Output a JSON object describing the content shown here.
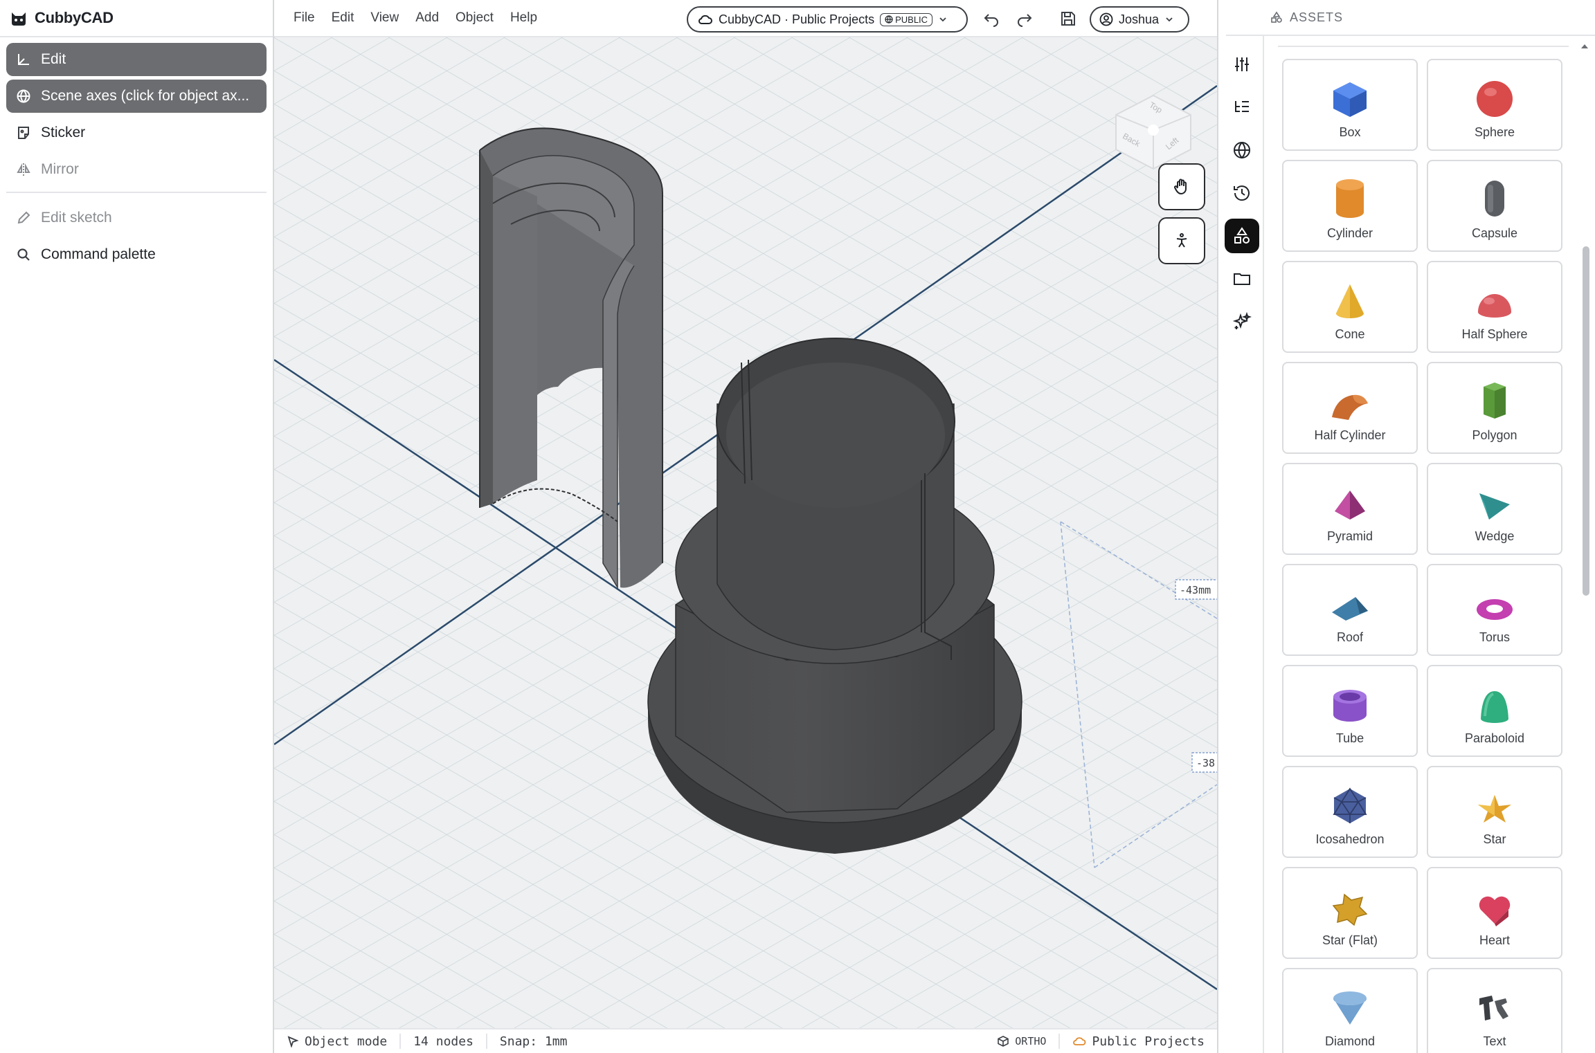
{
  "app": {
    "name": "CubbyCAD"
  },
  "left_menu": {
    "items": [
      {
        "label": "Edit",
        "icon": "axis-icon",
        "state": "active"
      },
      {
        "label": "Scene axes (click for object ax...",
        "icon": "globe-icon",
        "state": "active"
      },
      {
        "label": "Sticker",
        "icon": "sticker-icon",
        "state": "normal"
      },
      {
        "label": "Mirror",
        "icon": "mirror-icon",
        "state": "disabled"
      },
      {
        "label": "Edit sketch",
        "icon": "pencil-icon",
        "state": "disabled"
      },
      {
        "label": "Command palette",
        "icon": "search-icon",
        "state": "normal"
      }
    ]
  },
  "topbar": {
    "menus": [
      "File",
      "Edit",
      "View",
      "Add",
      "Object",
      "Help"
    ],
    "project": {
      "name": "CubbyCAD · Public Projects",
      "badge": "PUBLIC"
    },
    "user": "Joshua"
  },
  "viewport": {
    "nav_cube": {
      "top": "Top",
      "back": "Back",
      "left": "Left"
    },
    "dimensions": [
      "-43mm",
      "-38"
    ]
  },
  "status": {
    "mode": "Object mode",
    "nodes": "14 nodes",
    "snap": "Snap: 1mm",
    "projection": "ORTHO",
    "project": "Public Projects"
  },
  "assets": {
    "title": "ASSETS",
    "items": [
      {
        "label": "Box",
        "icon": "box-icon",
        "color": "#3b6fd6"
      },
      {
        "label": "Sphere",
        "icon": "sphere-icon",
        "color": "#d94a4a"
      },
      {
        "label": "Cylinder",
        "icon": "cylinder-icon",
        "color": "#e08a2c"
      },
      {
        "label": "Capsule",
        "icon": "capsule-icon",
        "color": "#5a5d61"
      },
      {
        "label": "Cone",
        "icon": "cone-icon",
        "color": "#e0a92a"
      },
      {
        "label": "Half Sphere",
        "icon": "half-sphere-icon",
        "color": "#d9585e"
      },
      {
        "label": "Half Cylinder",
        "icon": "half-cylinder-icon",
        "color": "#c96a2e"
      },
      {
        "label": "Polygon",
        "icon": "polygon-icon",
        "color": "#5a9a3a"
      },
      {
        "label": "Pyramid",
        "icon": "pyramid-icon",
        "color": "#a83e8c"
      },
      {
        "label": "Wedge",
        "icon": "wedge-icon",
        "color": "#2f8f8f"
      },
      {
        "label": "Roof",
        "icon": "roof-icon",
        "color": "#3f7ea8"
      },
      {
        "label": "Torus",
        "icon": "torus-icon",
        "color": "#c43fb0"
      },
      {
        "label": "Tube",
        "icon": "tube-icon",
        "color": "#8a52c8"
      },
      {
        "label": "Paraboloid",
        "icon": "paraboloid-icon",
        "color": "#2fae7f"
      },
      {
        "label": "Icosahedron",
        "icon": "icosahedron-icon",
        "color": "#4a5f9e"
      },
      {
        "label": "Star",
        "icon": "star-icon",
        "color": "#e0a02a"
      },
      {
        "label": "Star (Flat)",
        "icon": "star-flat-icon",
        "color": "#d4a02a"
      },
      {
        "label": "Heart",
        "icon": "heart-icon",
        "color": "#d9415e"
      },
      {
        "label": "Diamond",
        "icon": "diamond-icon",
        "color": "#6fa0d0"
      },
      {
        "label": "Text",
        "icon": "text-3d-icon",
        "color": "#3b3f44"
      }
    ]
  }
}
